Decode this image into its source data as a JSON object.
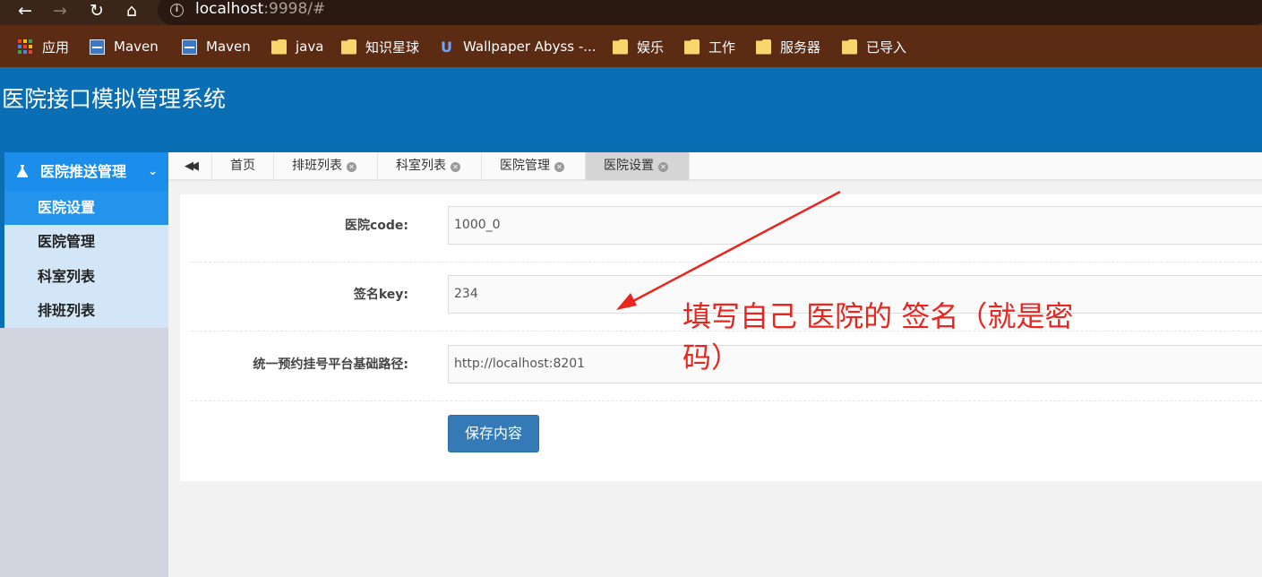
{
  "browser": {
    "url_host": "localhost",
    "url_rest": ":9998/#",
    "bookmarks": [
      {
        "label": "应用",
        "icon": "apps-grid-icon"
      },
      {
        "label": "Maven",
        "icon": "maven-icon"
      },
      {
        "label": "Maven",
        "icon": "maven-icon"
      },
      {
        "label": "java",
        "icon": "folder-icon"
      },
      {
        "label": "知识星球",
        "icon": "folder-icon"
      },
      {
        "label": "Wallpaper Abyss -...",
        "icon": "wallpaper-abyss-icon"
      },
      {
        "label": "娱乐",
        "icon": "folder-icon"
      },
      {
        "label": "工作",
        "icon": "folder-icon"
      },
      {
        "label": "服务器",
        "icon": "folder-icon"
      },
      {
        "label": "已导入",
        "icon": "folder-icon"
      }
    ]
  },
  "header": {
    "title": "医院接口模拟管理系统"
  },
  "sidebar": {
    "group_label": "医院推送管理",
    "items": [
      {
        "label": "医院设置",
        "active": true
      },
      {
        "label": "医院管理",
        "active": false
      },
      {
        "label": "科室列表",
        "active": false
      },
      {
        "label": "排班列表",
        "active": false
      }
    ]
  },
  "tabs": [
    {
      "label": "首页",
      "closable": false
    },
    {
      "label": "排班列表",
      "closable": true
    },
    {
      "label": "科室列表",
      "closable": true
    },
    {
      "label": "医院管理",
      "closable": true
    },
    {
      "label": "医院设置",
      "closable": true,
      "active": true
    }
  ],
  "form": {
    "fields": [
      {
        "label": "医院code:",
        "value": "1000_0"
      },
      {
        "label": "签名key:",
        "value": "234"
      },
      {
        "label": "统一预约挂号平台基础路径:",
        "value": "http://localhost:8201"
      }
    ],
    "save_label": "保存内容"
  },
  "annotation": {
    "text": "填写自己 医院的 签名（就是密码）",
    "color": "#e8261f"
  },
  "colors": {
    "header": "#0a6eb4",
    "sidebar_active": "#2493ec",
    "button": "#337ab7"
  }
}
